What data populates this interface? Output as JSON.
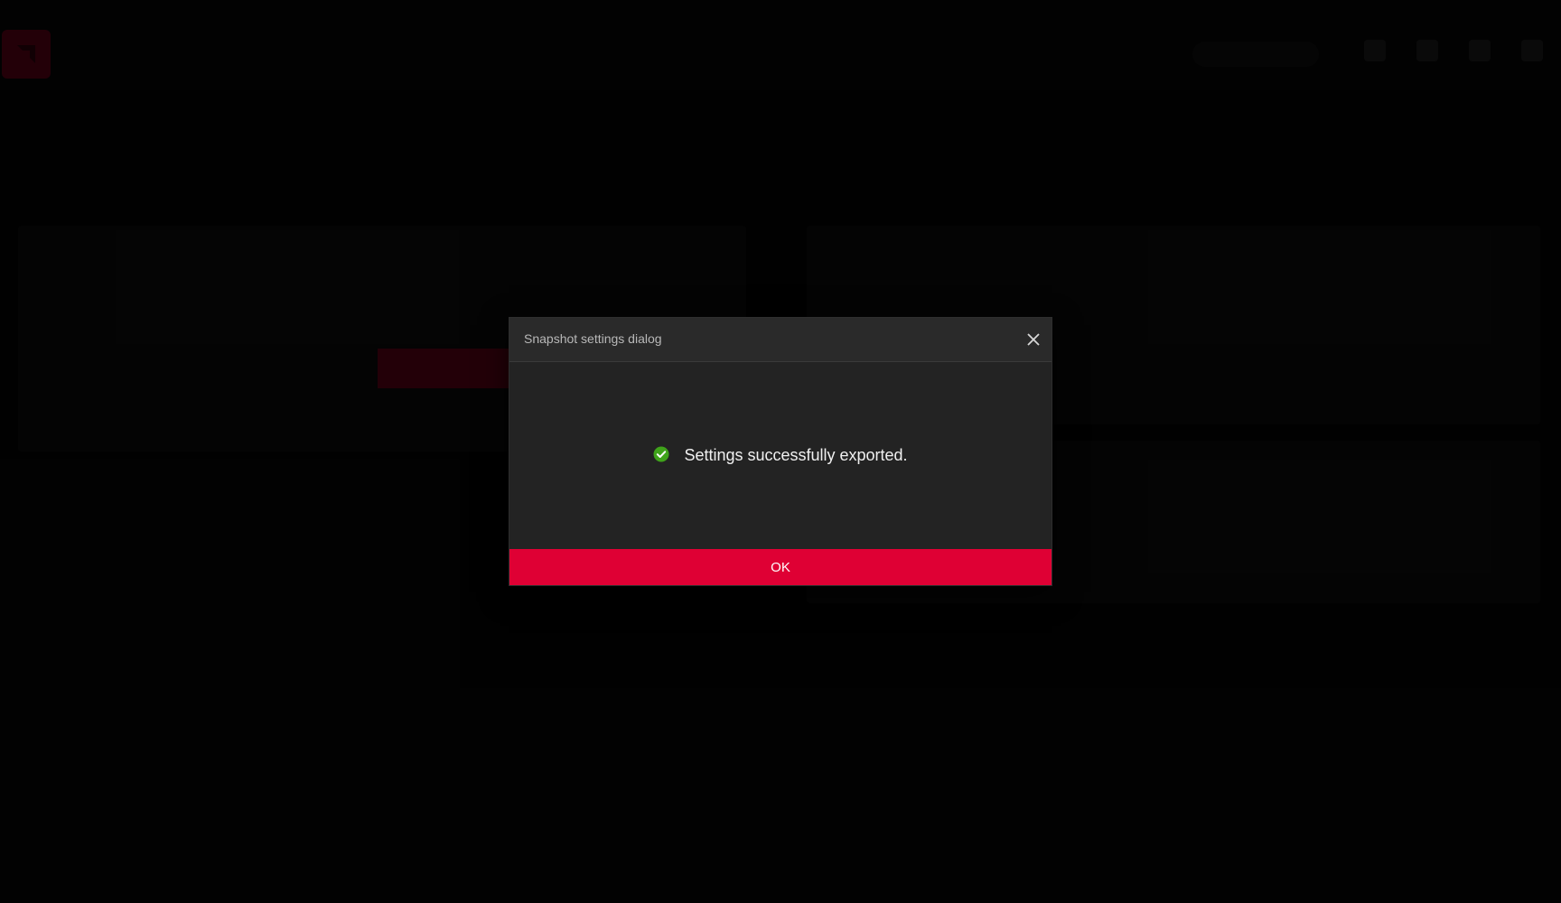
{
  "dialog": {
    "title": "Snapshot settings dialog",
    "message": "Settings successfully exported.",
    "ok_label": "OK",
    "success_color": "#3fa31a",
    "accent_color": "#df0034"
  },
  "icons": {
    "close": "close-icon",
    "success": "check-circle-icon"
  }
}
